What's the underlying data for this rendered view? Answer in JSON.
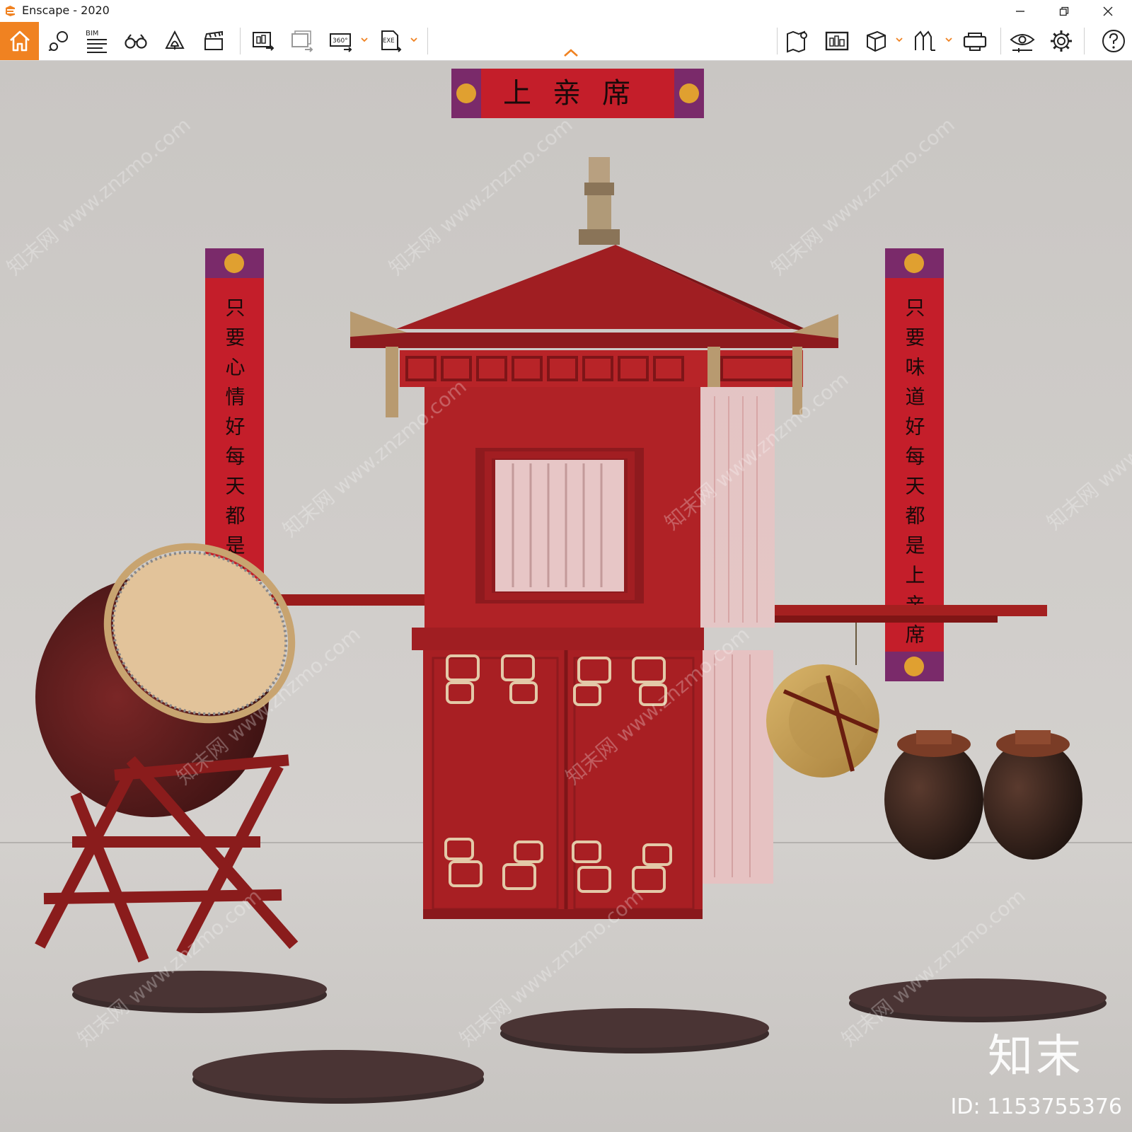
{
  "window": {
    "title": "Enscape - 2020",
    "controls": [
      "minimize",
      "restore",
      "close"
    ]
  },
  "toolbar": {
    "home_icon": "home-icon",
    "bim_label": "BIM",
    "video_360_label": "360°",
    "exe_label": "EXE",
    "accent_color": "#f08221"
  },
  "scene": {
    "top_banner_text": "上亲席",
    "left_couplet": "只要心情好每天都是好",
    "right_couplet": "只要味道好每天都是上亲席"
  },
  "watermark": {
    "brand": "知末",
    "asset_id": "ID: 1153755376",
    "diagonal_text": "知末网 www.znzmo.com"
  }
}
